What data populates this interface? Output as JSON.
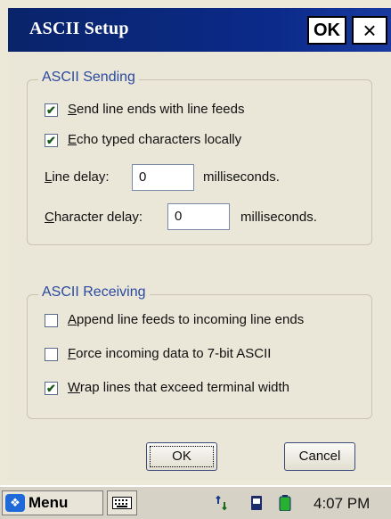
{
  "window": {
    "title": "ASCII Setup",
    "titlebar_ok": "OK",
    "titlebar_close": "×"
  },
  "ascii_sending": {
    "group_title": "ASCII Sending",
    "send_line_ends_first": "S",
    "send_line_ends_rest": "end line ends with line feeds",
    "send_line_ends_checked": true,
    "echo_first": "E",
    "echo_rest": "cho typed characters locally",
    "echo_checked": true,
    "line_delay_first": "L",
    "line_delay_rest": "ine delay:",
    "line_delay_value": "0",
    "line_delay_unit": "milliseconds.",
    "char_delay_first": "C",
    "char_delay_rest": "haracter delay:",
    "char_delay_value": "0",
    "char_delay_unit": "milliseconds."
  },
  "ascii_receiving": {
    "group_title": "ASCII Receiving",
    "append_first": "A",
    "append_rest": "ppend line feeds to incoming line ends",
    "append_checked": false,
    "force_first": "F",
    "force_rest": "orce incoming data to 7-bit ASCII",
    "force_checked": false,
    "wrap_first": "W",
    "wrap_rest": "rap lines that exceed terminal width",
    "wrap_checked": true
  },
  "buttons": {
    "ok": "OK",
    "cancel": "Cancel"
  },
  "taskbar": {
    "start_label": "Menu",
    "clock": "4:07 PM"
  },
  "colors": {
    "titlebar": "#0b2a8a",
    "group_title": "#2a4aa0",
    "check_mark": "#1a5a1a"
  },
  "icons": [
    "windows-flag-icon",
    "keyboard-icon",
    "network-icon",
    "storage-card-icon",
    "battery-icon"
  ]
}
